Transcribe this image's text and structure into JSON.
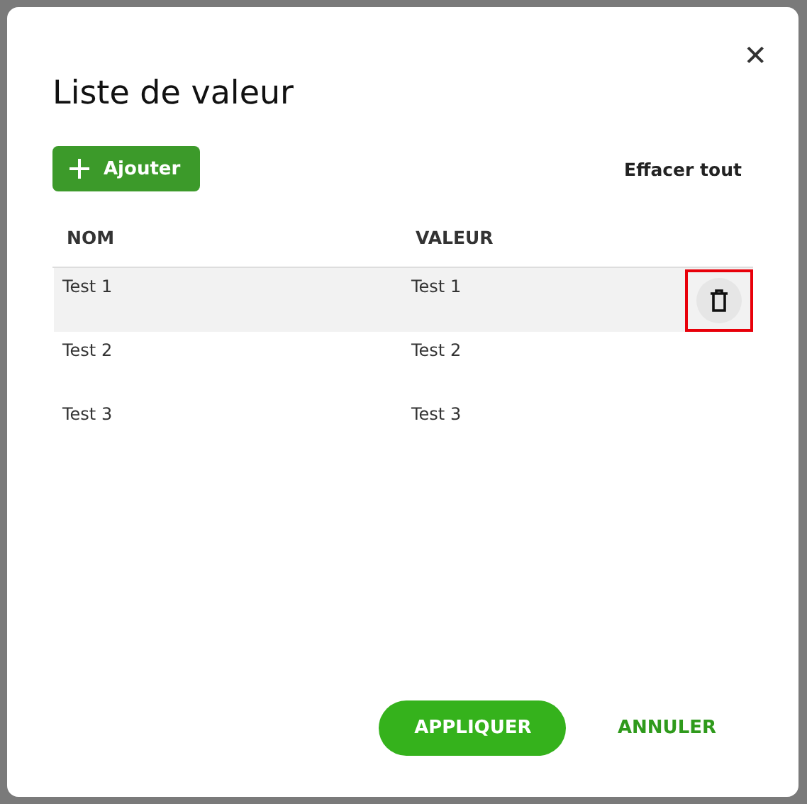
{
  "dialog": {
    "title": "Liste de valeur",
    "close": "✕"
  },
  "toolbar": {
    "add_label": "Ajouter",
    "clear_label": "Effacer tout"
  },
  "table": {
    "columns": [
      "NOM",
      "VALEUR"
    ],
    "rows": [
      {
        "cells": [
          "Test 1",
          "Test 1"
        ],
        "selected": true,
        "highlighted": true
      },
      {
        "cells": [
          "Test 2",
          "Test 2"
        ],
        "selected": false,
        "highlighted": false
      },
      {
        "cells": [
          "Test 3",
          "Test 3"
        ],
        "selected": false,
        "highlighted": false
      }
    ]
  },
  "buttons": [
    {
      "label": "APPLIQUER",
      "kind": "primary"
    },
    {
      "label": "ANNULER",
      "kind": "text"
    }
  ]
}
